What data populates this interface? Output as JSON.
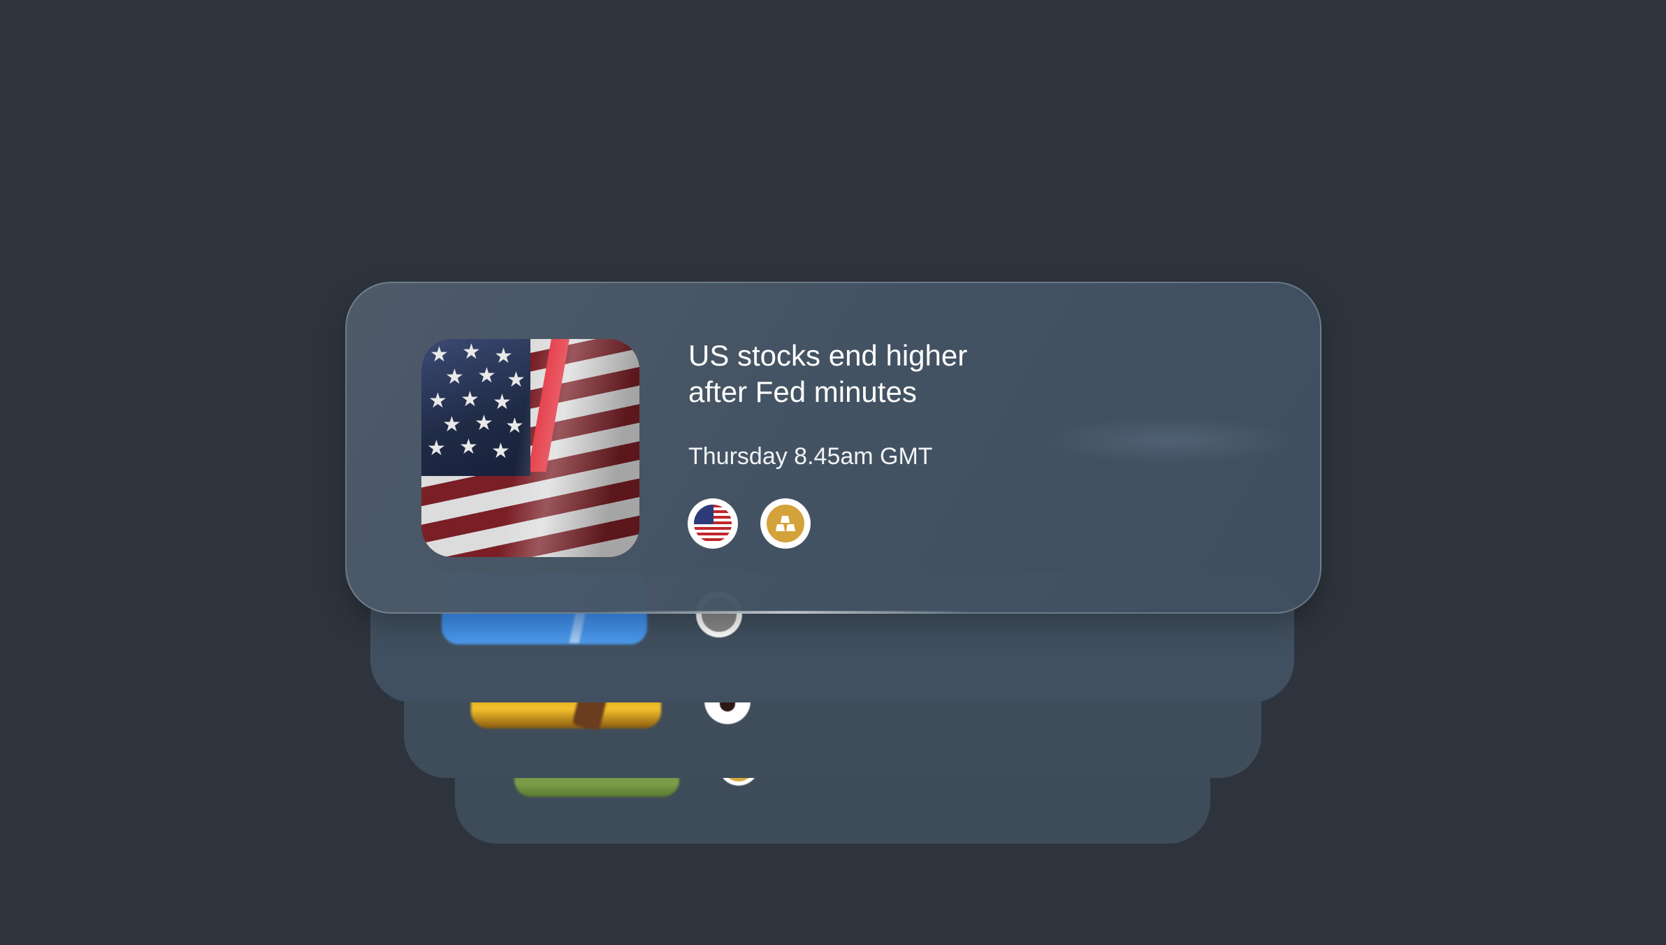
{
  "news_stack": {
    "front_card": {
      "headline_line1": "US stocks end higher",
      "headline_line2": "after Fed minutes",
      "timestamp": "Thursday 8.45am GMT",
      "image_icon": "us-flag-photo",
      "tags": [
        {
          "icon": "us-flag-icon"
        },
        {
          "icon": "gold-bars-icon"
        }
      ]
    },
    "back_cards": [
      {
        "image_icon": "sky-photo",
        "tag_icon": "gold-bars-icon"
      },
      {
        "image_icon": "gold-photo",
        "tag_icon": "apple-icon"
      },
      {
        "image_icon": "grass-photo",
        "tag_icon": "gold-coin-icon"
      }
    ]
  },
  "colors": {
    "background": "#2e343d",
    "card": "#4a5866",
    "text": "#ffffff",
    "gold": "#d4a23a",
    "flag_red": "#c1272d",
    "flag_blue": "#2d3c78"
  }
}
